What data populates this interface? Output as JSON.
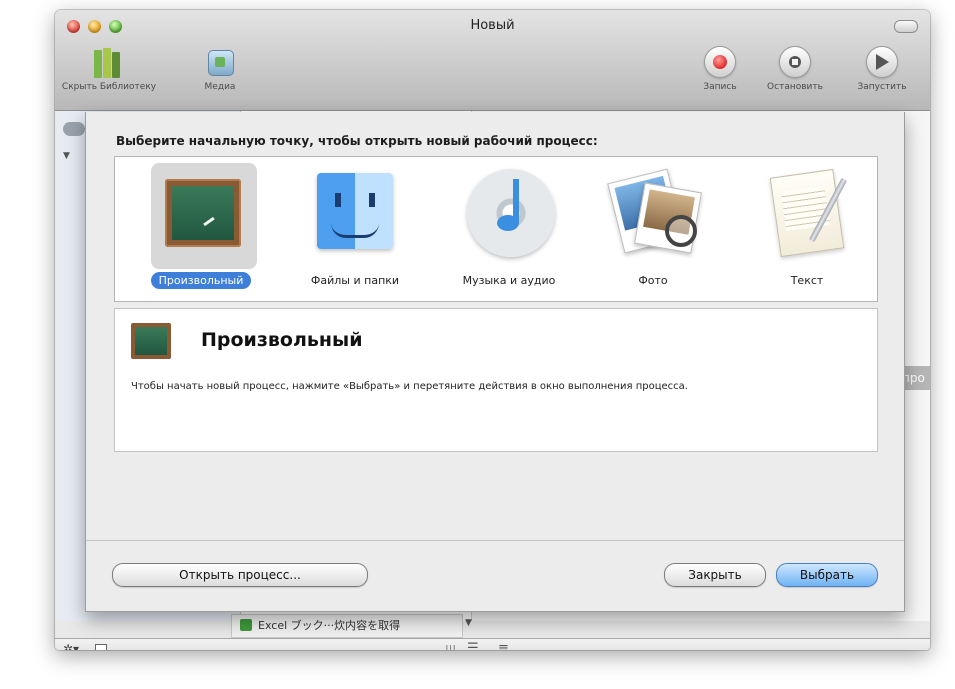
{
  "window": {
    "title": "Новый"
  },
  "toolbar": {
    "hide_library": "Скрыть Библиотеку",
    "media": "Медиа",
    "record": "Запись",
    "stop": "Остановить",
    "run": "Запустить"
  },
  "background": {
    "cut_label": "про",
    "action_row_text": "Excel ブック···炊内容を取得"
  },
  "sheet": {
    "prompt": "Выберите начальную точку, чтобы открыть новый рабочий процесс:",
    "templates": [
      {
        "label": "Произвольный",
        "icon": "chalkboard-icon",
        "selected": true
      },
      {
        "label": "Файлы и папки",
        "icon": "finder-icon",
        "selected": false
      },
      {
        "label": "Музыка и аудио",
        "icon": "itunes-icon",
        "selected": false
      },
      {
        "label": "Фото",
        "icon": "photos-icon",
        "selected": false
      },
      {
        "label": "Текст",
        "icon": "text-document-icon",
        "selected": false
      }
    ],
    "description": {
      "title": "Произвольный",
      "text": "Чтобы начать новый процесс, нажмите «Выбрать» и перетяните действия в окно выполнения процесса."
    },
    "buttons": {
      "open": "Открыть процесс...",
      "close": "Закрыть",
      "choose": "Выбрать"
    }
  },
  "colors": {
    "selection": "#3d7fd9",
    "default_button": "#6fb2f3"
  }
}
